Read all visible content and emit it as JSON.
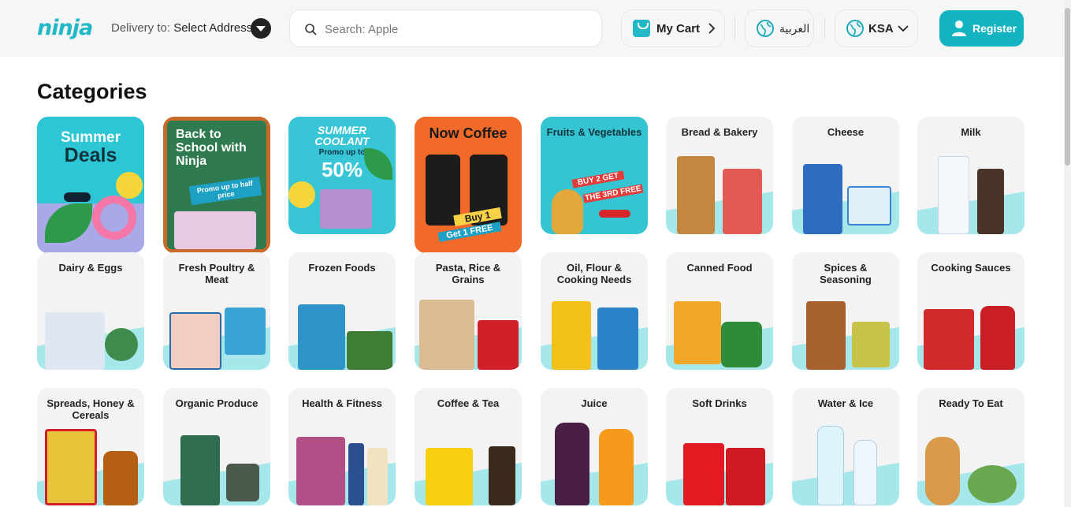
{
  "header": {
    "logo": "ninja",
    "delivery_label": "Delivery to:",
    "delivery_value": "Select Address",
    "search_placeholder": "Search: Apple",
    "cart_label": "My Cart",
    "language_label": "العربية",
    "country_label": "KSA",
    "register_label": "Register"
  },
  "colors": {
    "brand": "#22b8c6",
    "register": "#14b3c1",
    "wave": "#a6e7ec"
  },
  "main": {
    "heading": "Categories",
    "promos": [
      {
        "line1": "Summer",
        "line2": "Deals"
      },
      {
        "line1": "Back to School with Ninja",
        "line2": "Promo up to half price"
      },
      {
        "line1": "SUMMER COOLANT",
        "line2": "Promo up to",
        "line3": "50%"
      },
      {
        "line1": "Now Coffee",
        "line2": "Buy 1",
        "line3": "Get 1 FREE"
      }
    ],
    "fruits": {
      "label": "Fruits & Vegetables",
      "offer1": "BUY 2 GET",
      "offer2": "THE 3RD FREE"
    },
    "categories": [
      "Bread & Bakery",
      "Cheese",
      "Milk",
      "Dairy & Eggs",
      "Fresh Poultry & Meat",
      "Frozen Foods",
      "Pasta, Rice & Grains",
      "Oil, Flour & Cooking Needs",
      "Canned Food",
      "Spices & Seasoning",
      "Cooking Sauces",
      "Spreads, Honey & Cereals",
      "Organic Produce",
      "Health & Fitness",
      "Coffee & Tea",
      "Juice",
      "Soft Drinks",
      "Water & Ice",
      "Ready To Eat"
    ]
  }
}
